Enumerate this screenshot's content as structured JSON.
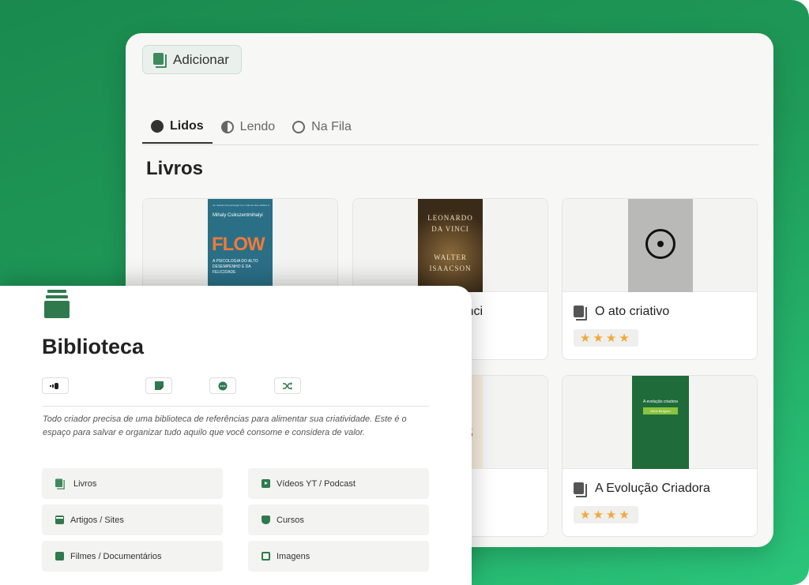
{
  "colors": {
    "accent_green": "#2f7a4d",
    "backdrop_green": "#1f9a58",
    "star": "#f2a83a"
  },
  "back_window": {
    "add_button": {
      "label": "Adicionar",
      "icon": "book-icon"
    },
    "tabs": [
      {
        "label": "Lidos",
        "icon": "filled-circle-icon",
        "active": true
      },
      {
        "label": "Lendo",
        "icon": "half-circle-icon",
        "active": false
      },
      {
        "label": "Na Fila",
        "icon": "empty-circle-icon",
        "active": false
      }
    ],
    "heading": "Livros",
    "cards": [
      {
        "title": "",
        "rating": 0,
        "cover": {
          "kind": "flow",
          "line1": "um clássico da psicologia com mais de dois milhões de exemplares vendidos",
          "author": "Mihaly Csikszentmihalyi",
          "title": "FLOW",
          "subtitle": "A PSICOLOGIA DO ALTO DESEMPENHO E DA FELICIDADE"
        }
      },
      {
        "title": "inci",
        "rating": 0,
        "cover": {
          "kind": "davinci",
          "top1": "LEONARDO",
          "top2": "DA VINCI",
          "bot1": "WALTER",
          "bot2": "ISAACSON"
        }
      },
      {
        "title": "O ato criativo",
        "rating": 4,
        "stars": "★★★★",
        "cover": {
          "kind": "ato"
        }
      },
      {
        "title": "",
        "rating": 0,
        "cover": {
          "kind": "partial",
          "glyph": "S"
        }
      },
      {
        "title": "A Evolução Criadora",
        "rating": 4,
        "stars": "★★★★",
        "cover": {
          "kind": "evol",
          "line1": "A evolução criadora",
          "line2": "Henri Bergson"
        }
      }
    ]
  },
  "front_window": {
    "icon": "library-stack-icon",
    "title": "Biblioteca",
    "mini_icons": [
      "audio-icon",
      "note-icon",
      "chat-icon",
      "shuffle-icon"
    ],
    "description": "Todo criador precisa de uma biblioteca de referências para alimentar sua criatividade. Este é o espaço para salvar e organizar tudo aquilo que você consome e considera de valor.",
    "nav": [
      {
        "label": "Livros",
        "icon": "book-icon"
      },
      {
        "label": "Vídeos YT / Podcast",
        "icon": "play-icon"
      },
      {
        "label": "Artigos / Sites",
        "icon": "window-icon"
      },
      {
        "label": "Cursos",
        "icon": "graduation-cap-icon"
      },
      {
        "label": "Filmes / Documentários",
        "icon": "film-camera-icon"
      },
      {
        "label": "Imagens",
        "icon": "image-icon"
      }
    ]
  }
}
